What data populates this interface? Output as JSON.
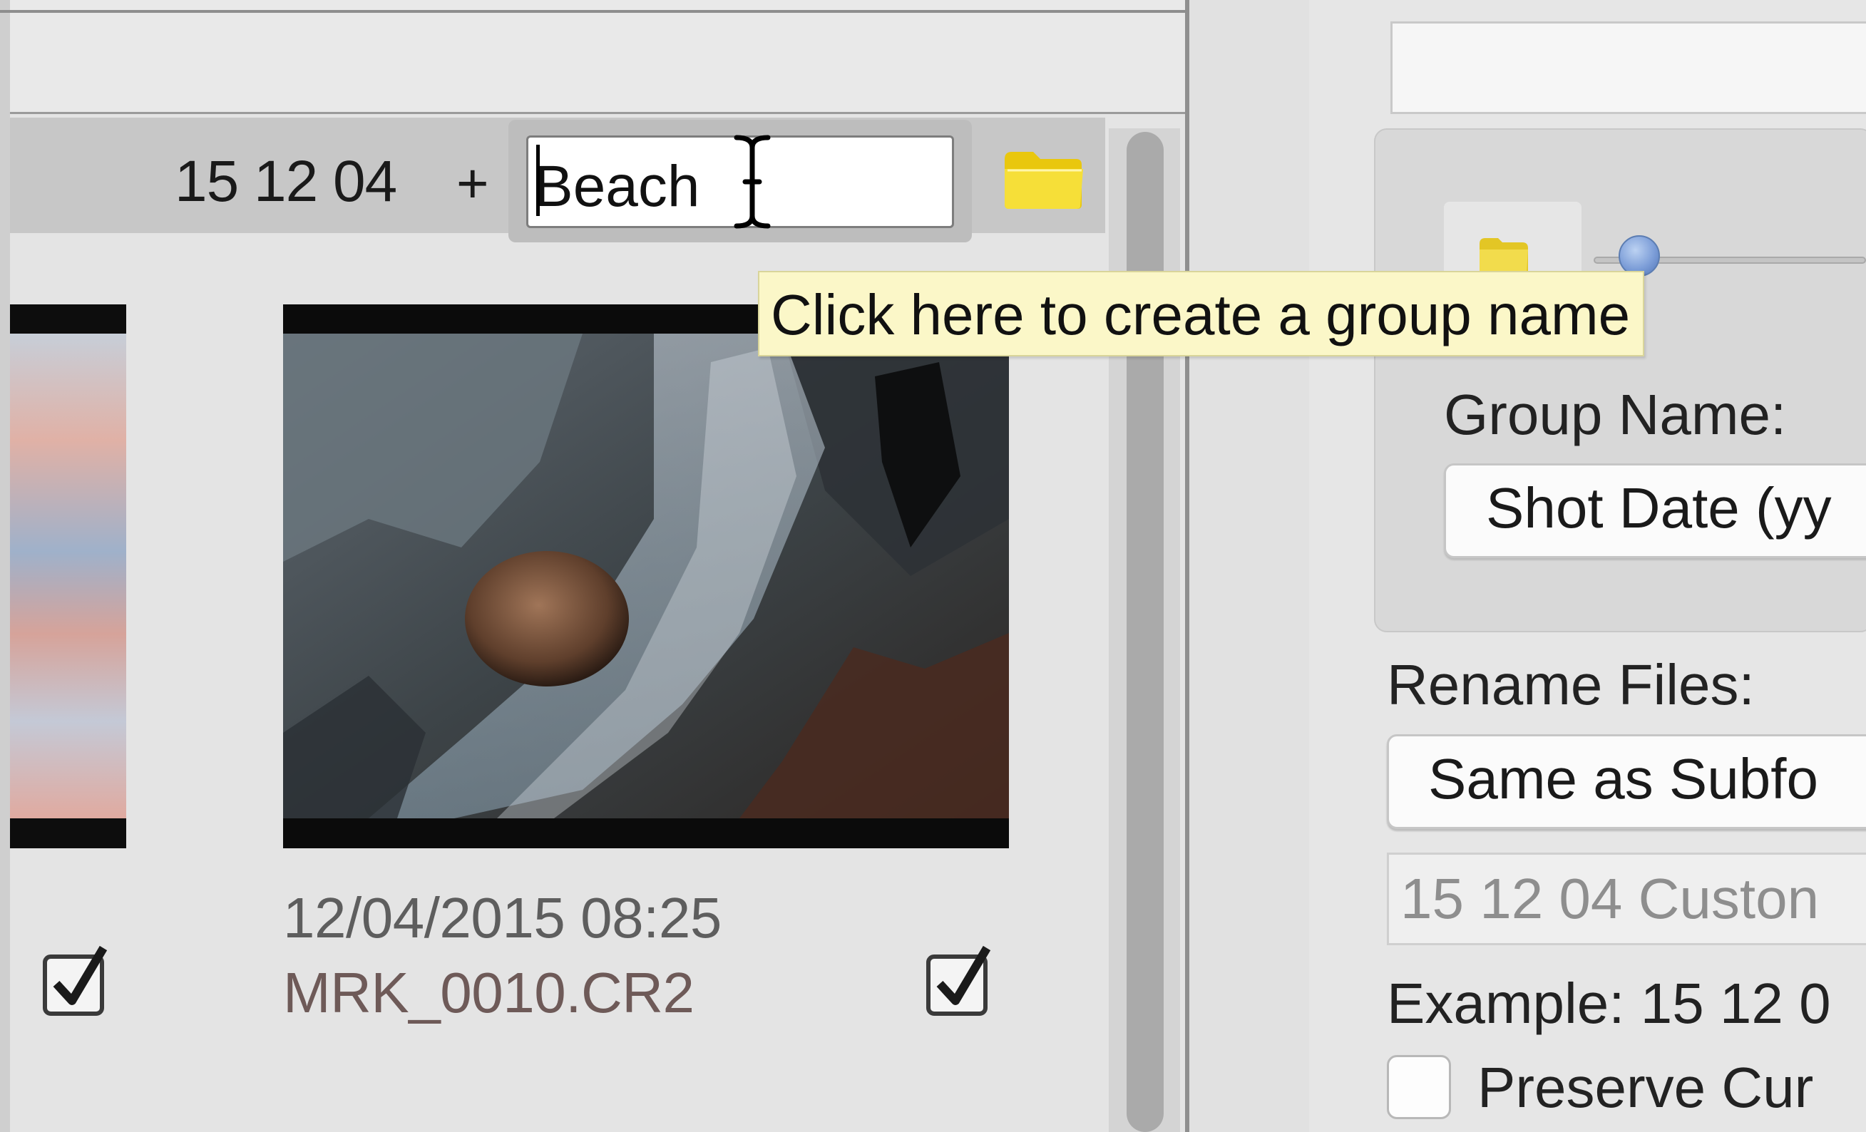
{
  "group": {
    "date": "15 12 04",
    "plus": "+",
    "name_value": "Beach"
  },
  "tooltip": {
    "text": "Click here to create a group name"
  },
  "thumbnail": {
    "date": "12/04/2015 08:25",
    "filename": "MRK_0010.CR2"
  },
  "options": {
    "group_name_label": "Group Name:",
    "group_name_select": "Shot Date (yy",
    "rename_label": "Rename Files:",
    "rename_select": "Same as Subfo",
    "custom_name": "15 12 04 Custon",
    "example": "Example: 15 12 0",
    "preserve_label": "Preserve Cur"
  },
  "icons": [
    "folder-icon",
    "checkbox-icon",
    "ibeam-cursor-icon",
    "slider-knob"
  ],
  "colors": {
    "tooltip_bg": "#fbf7c8",
    "folder_yellow": "#f2d51a",
    "slider_blue": "#7d9ed8"
  }
}
